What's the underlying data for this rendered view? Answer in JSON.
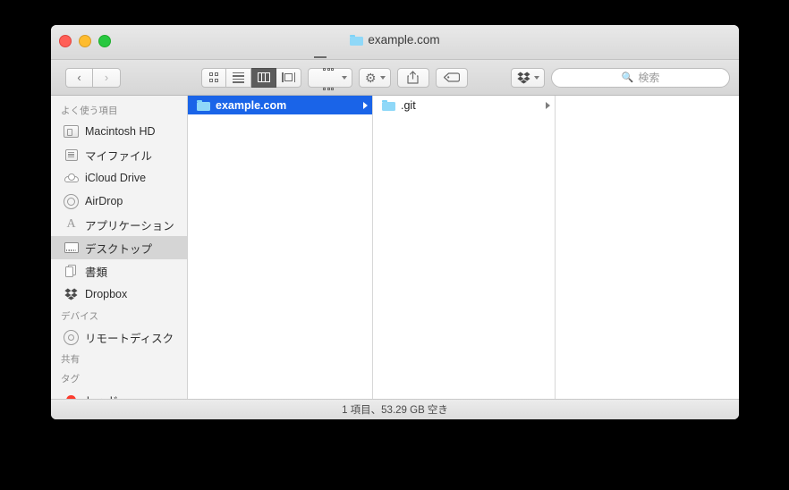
{
  "window": {
    "title": "example.com",
    "title_icon": "folder-icon",
    "traffic_lights": {
      "close": "close-button",
      "minimize": "minimize-button",
      "maximize": "maximize-button"
    }
  },
  "toolbar": {
    "back_label": "‹",
    "forward_label": "›",
    "view_modes": [
      {
        "name": "icon-view",
        "active": false
      },
      {
        "name": "list-view",
        "active": false
      },
      {
        "name": "column-view",
        "active": true
      },
      {
        "name": "coverflow-view",
        "active": false
      }
    ],
    "arrange_label": "",
    "action_label": "⚙",
    "share_label": "",
    "tags_label": "",
    "dropbox_label": ""
  },
  "search": {
    "placeholder": "検索",
    "value": "",
    "icon": "search-icon"
  },
  "sidebar": {
    "sections": [
      {
        "header": "よく使う項目",
        "items": [
          {
            "label": "Macintosh HD",
            "icon": "harddisk-icon",
            "selected": false
          },
          {
            "label": "マイファイル",
            "icon": "myfiles-icon",
            "selected": false
          },
          {
            "label": "iCloud Drive",
            "icon": "cloud-icon",
            "selected": false
          },
          {
            "label": "AirDrop",
            "icon": "airdrop-icon",
            "selected": false
          },
          {
            "label": "アプリケーション",
            "icon": "applications-icon",
            "selected": false
          },
          {
            "label": "デスクトップ",
            "icon": "desktop-icon",
            "selected": true
          },
          {
            "label": "書類",
            "icon": "documents-icon",
            "selected": false
          },
          {
            "label": "Dropbox",
            "icon": "dropbox-icon",
            "selected": false
          }
        ]
      },
      {
        "header": "デバイス",
        "items": [
          {
            "label": "リモートディスク",
            "icon": "remotedisc-icon",
            "selected": false
          }
        ]
      },
      {
        "header": "共有",
        "items": []
      },
      {
        "header": "タグ",
        "items": [
          {
            "label": "レッド",
            "icon": "tag-red-icon",
            "selected": false
          }
        ]
      }
    ]
  },
  "columns": [
    {
      "name": "column-1",
      "rows": [
        {
          "label": "example.com",
          "icon": "folder-icon",
          "selected": true,
          "has_children": true
        }
      ]
    },
    {
      "name": "column-2",
      "rows": [
        {
          "label": ".git",
          "icon": "folder-icon",
          "selected": false,
          "has_children": true
        }
      ]
    },
    {
      "name": "column-3",
      "rows": []
    }
  ],
  "statusbar": {
    "text": "1 項目、53.29 GB 空き"
  },
  "colors": {
    "selection_blue": "#1a64e8",
    "sidebar_selection": "#d5d5d5",
    "folder_blue": "#8fd8f8",
    "tag_red": "#fc3b2d",
    "desktop_background": "#000000"
  }
}
